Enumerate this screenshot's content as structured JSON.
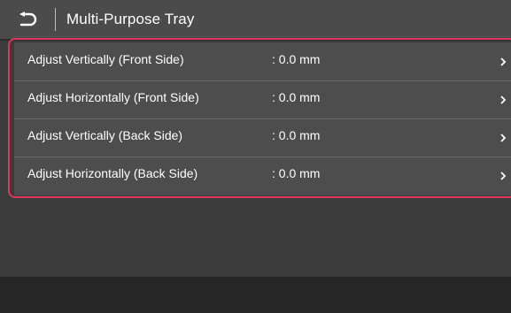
{
  "header": {
    "title": "Multi-Purpose Tray",
    "back_icon": "back-arrow-icon"
  },
  "settings": [
    {
      "label": "Adjust Vertically (Front Side)",
      "value": ": 0.0 mm"
    },
    {
      "label": "Adjust Horizontally (Front Side)",
      "value": ": 0.0 mm"
    },
    {
      "label": "Adjust Vertically (Back Side)",
      "value": ": 0.0 mm"
    },
    {
      "label": "Adjust Horizontally (Back Side)",
      "value": ": 0.0 mm"
    }
  ],
  "colors": {
    "background": "#3b3b3b",
    "title_bar": "#4b4b4b",
    "list_background": "#4d4d4d",
    "highlight_outline": "#e0345a",
    "bottom_bar": "#262626"
  }
}
